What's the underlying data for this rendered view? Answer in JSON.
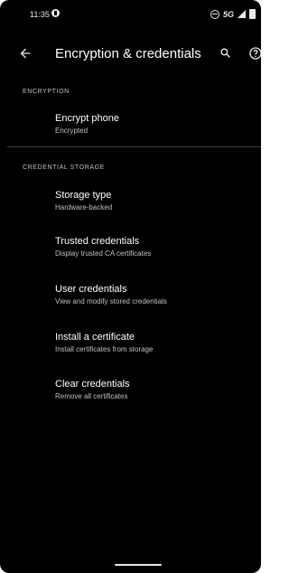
{
  "status": {
    "time": "11:35",
    "network": "5G"
  },
  "appbar": {
    "title": "Encryption & credentials"
  },
  "sections": [
    {
      "header": "ENCRYPTION",
      "items": [
        {
          "title": "Encrypt phone",
          "summary": "Encrypted"
        }
      ]
    },
    {
      "header": "CREDENTIAL STORAGE",
      "items": [
        {
          "title": "Storage type",
          "summary": "Hardware-backed"
        },
        {
          "title": "Trusted credentials",
          "summary": "Display trusted CA certificates"
        },
        {
          "title": "User credentials",
          "summary": "View and modify stored credentials"
        },
        {
          "title": "Install a certificate",
          "summary": "Install certificates from storage"
        },
        {
          "title": "Clear credentials",
          "summary": "Remove all certificates"
        }
      ]
    }
  ],
  "colors": {
    "background": "#000000",
    "text_primary": "#ffffff",
    "text_secondary": "#bdc1c6"
  },
  "icons": [
    "back-arrow-icon",
    "search-icon",
    "help-icon",
    "dnd-icon",
    "signal-icon",
    "battery-icon"
  ]
}
